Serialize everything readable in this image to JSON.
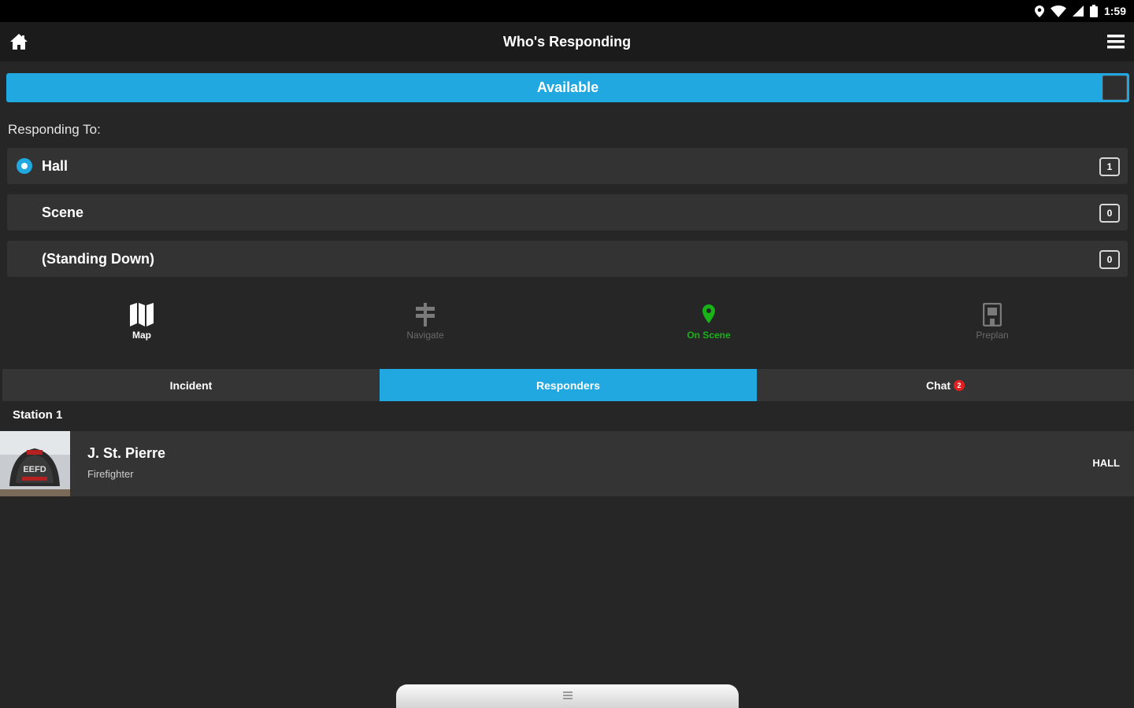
{
  "status_bar": {
    "time": "1:59",
    "icons": [
      "location-icon",
      "wifi-icon",
      "signal-icon",
      "battery-icon"
    ]
  },
  "app_bar": {
    "title": "Who's Responding",
    "home_icon": "home-icon",
    "menu_icon": "menu-icon"
  },
  "availability": {
    "label": "Available",
    "color": "#21a8e0"
  },
  "responding": {
    "label": "Responding To:",
    "options": [
      {
        "label": "Hall",
        "count": "1",
        "selected": true
      },
      {
        "label": "Scene",
        "count": "0",
        "selected": false
      },
      {
        "label": "(Standing Down)",
        "count": "0",
        "selected": false
      }
    ]
  },
  "actions": [
    {
      "label": "Map",
      "icon": "map-icon"
    },
    {
      "label": "Navigate",
      "icon": "signpost-icon"
    },
    {
      "label": "On Scene",
      "icon": "map-pin-icon",
      "color": "#17b317"
    },
    {
      "label": "Preplan",
      "icon": "building-icon"
    }
  ],
  "tabs": [
    {
      "label": "Incident"
    },
    {
      "label": "Responders",
      "active": true
    },
    {
      "label": "Chat",
      "badge": "2"
    }
  ],
  "section": {
    "title": "Station 1"
  },
  "responders": [
    {
      "name": "J. St. Pierre",
      "role": "Firefighter",
      "status": "HALL",
      "avatar_text": "EEFD"
    }
  ],
  "colors": {
    "accent": "#21a8e0",
    "background": "#262626",
    "badge": "#e02020",
    "green": "#17b317"
  }
}
